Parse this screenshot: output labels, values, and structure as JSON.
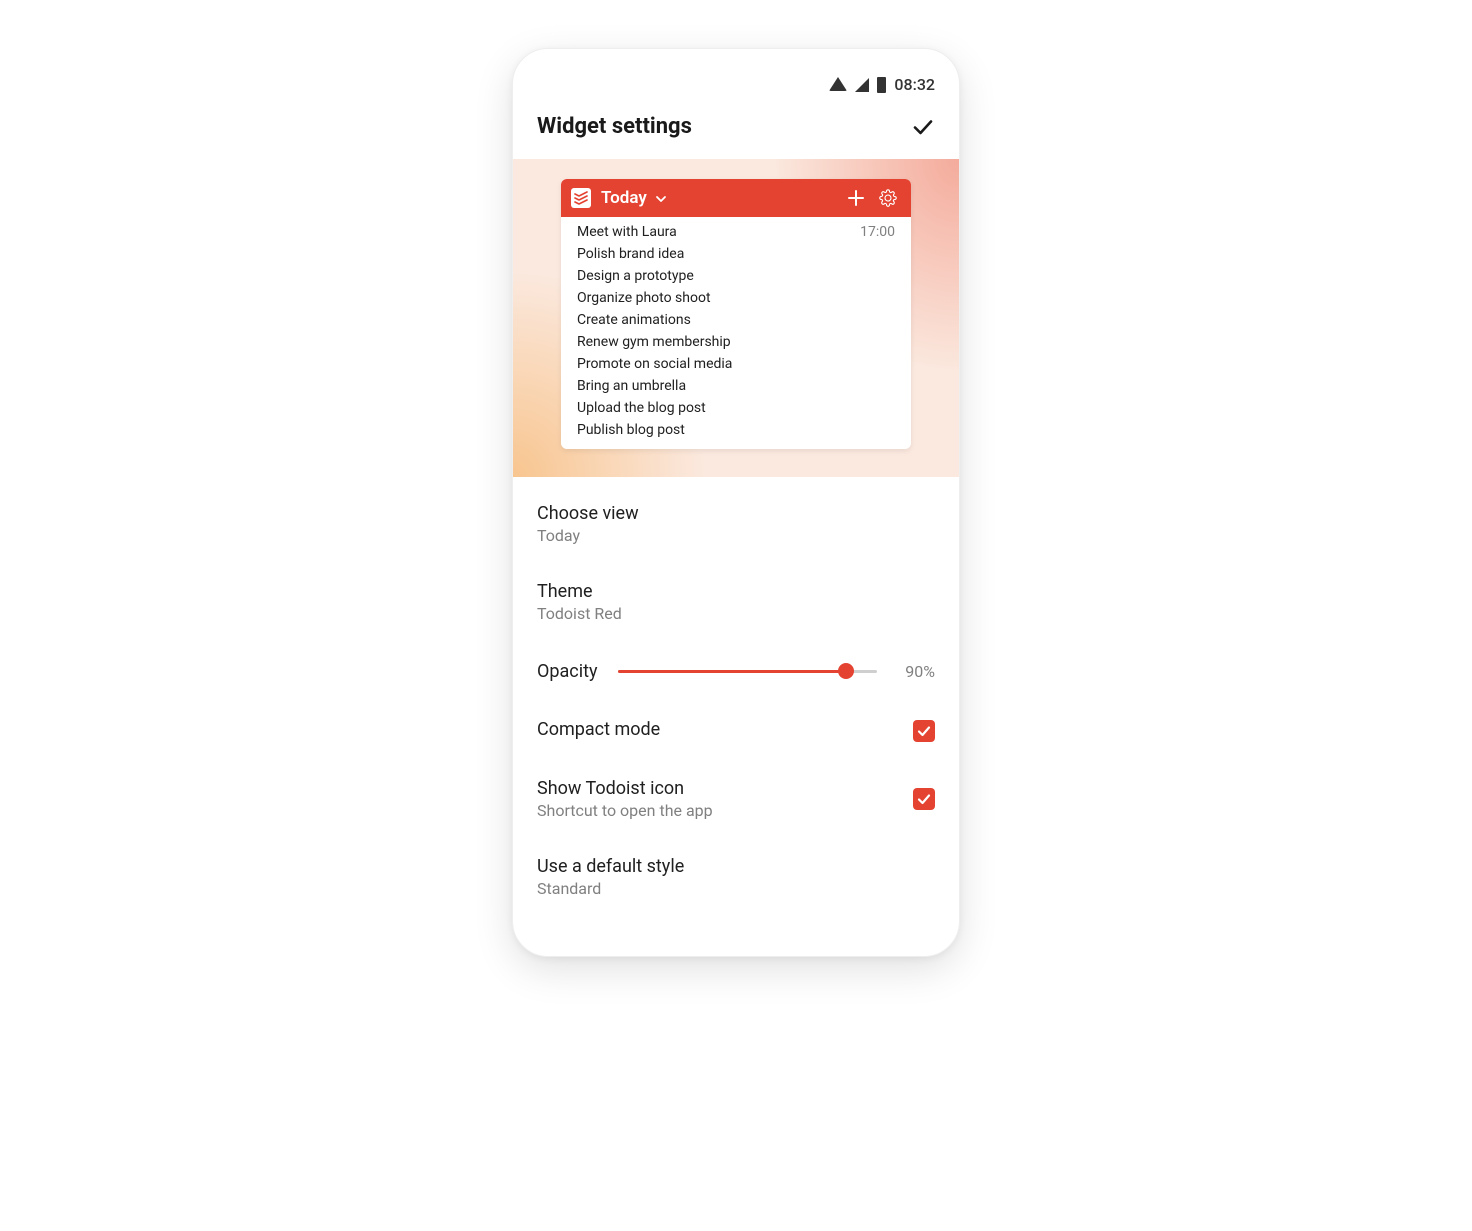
{
  "status": {
    "time": "08:32"
  },
  "header": {
    "title": "Widget settings"
  },
  "widget": {
    "view_label": "Today",
    "tasks": [
      {
        "title": "Meet with Laura",
        "time": "17:00"
      },
      {
        "title": "Polish brand idea",
        "time": ""
      },
      {
        "title": "Design a prototype",
        "time": ""
      },
      {
        "title": "Organize photo shoot",
        "time": ""
      },
      {
        "title": "Create animations",
        "time": ""
      },
      {
        "title": "Renew gym membership",
        "time": ""
      },
      {
        "title": "Promote on social media",
        "time": ""
      },
      {
        "title": "Bring an umbrella",
        "time": ""
      },
      {
        "title": "Upload the blog post",
        "time": ""
      },
      {
        "title": "Publish blog post",
        "time": ""
      }
    ]
  },
  "settings": {
    "choose_view": {
      "label": "Choose view",
      "value": "Today"
    },
    "theme": {
      "label": "Theme",
      "value": "Todoist Red"
    },
    "opacity": {
      "label": "Opacity",
      "value": 90,
      "display": "90%"
    },
    "compact": {
      "label": "Compact mode",
      "checked": true
    },
    "show_icon": {
      "label": "Show Todoist icon",
      "sub": "Shortcut to open the app",
      "checked": true
    },
    "default_style": {
      "label": "Use a default style",
      "value": "Standard"
    }
  },
  "colors": {
    "accent": "#e44332"
  }
}
